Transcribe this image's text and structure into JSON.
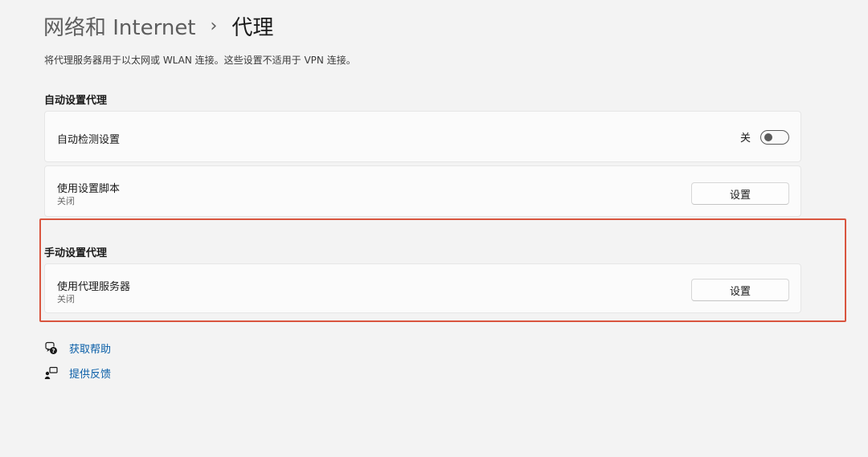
{
  "header": {
    "parent": "网络和 Internet",
    "separator": "›",
    "current": "代理"
  },
  "description": "将代理服务器用于以太网或 WLAN 连接。这些设置不适用于 VPN 连接。",
  "auto_section": {
    "title": "自动设置代理",
    "detect": {
      "label": "自动检测设置",
      "toggle_state": "关",
      "toggle_on": false
    },
    "script": {
      "label": "使用设置脚本",
      "status": "关闭",
      "button": "设置"
    }
  },
  "manual_section": {
    "title": "手动设置代理",
    "proxy": {
      "label": "使用代理服务器",
      "status": "关闭",
      "button": "设置"
    }
  },
  "links": {
    "help": "获取帮助",
    "feedback": "提供反馈"
  },
  "colors": {
    "background": "#f3f3f3",
    "card": "#fbfbfb",
    "link": "#0a5fa8",
    "highlight_border": "#d9553f"
  },
  "icons": {
    "help": "help-chat-icon",
    "feedback": "feedback-icon"
  }
}
